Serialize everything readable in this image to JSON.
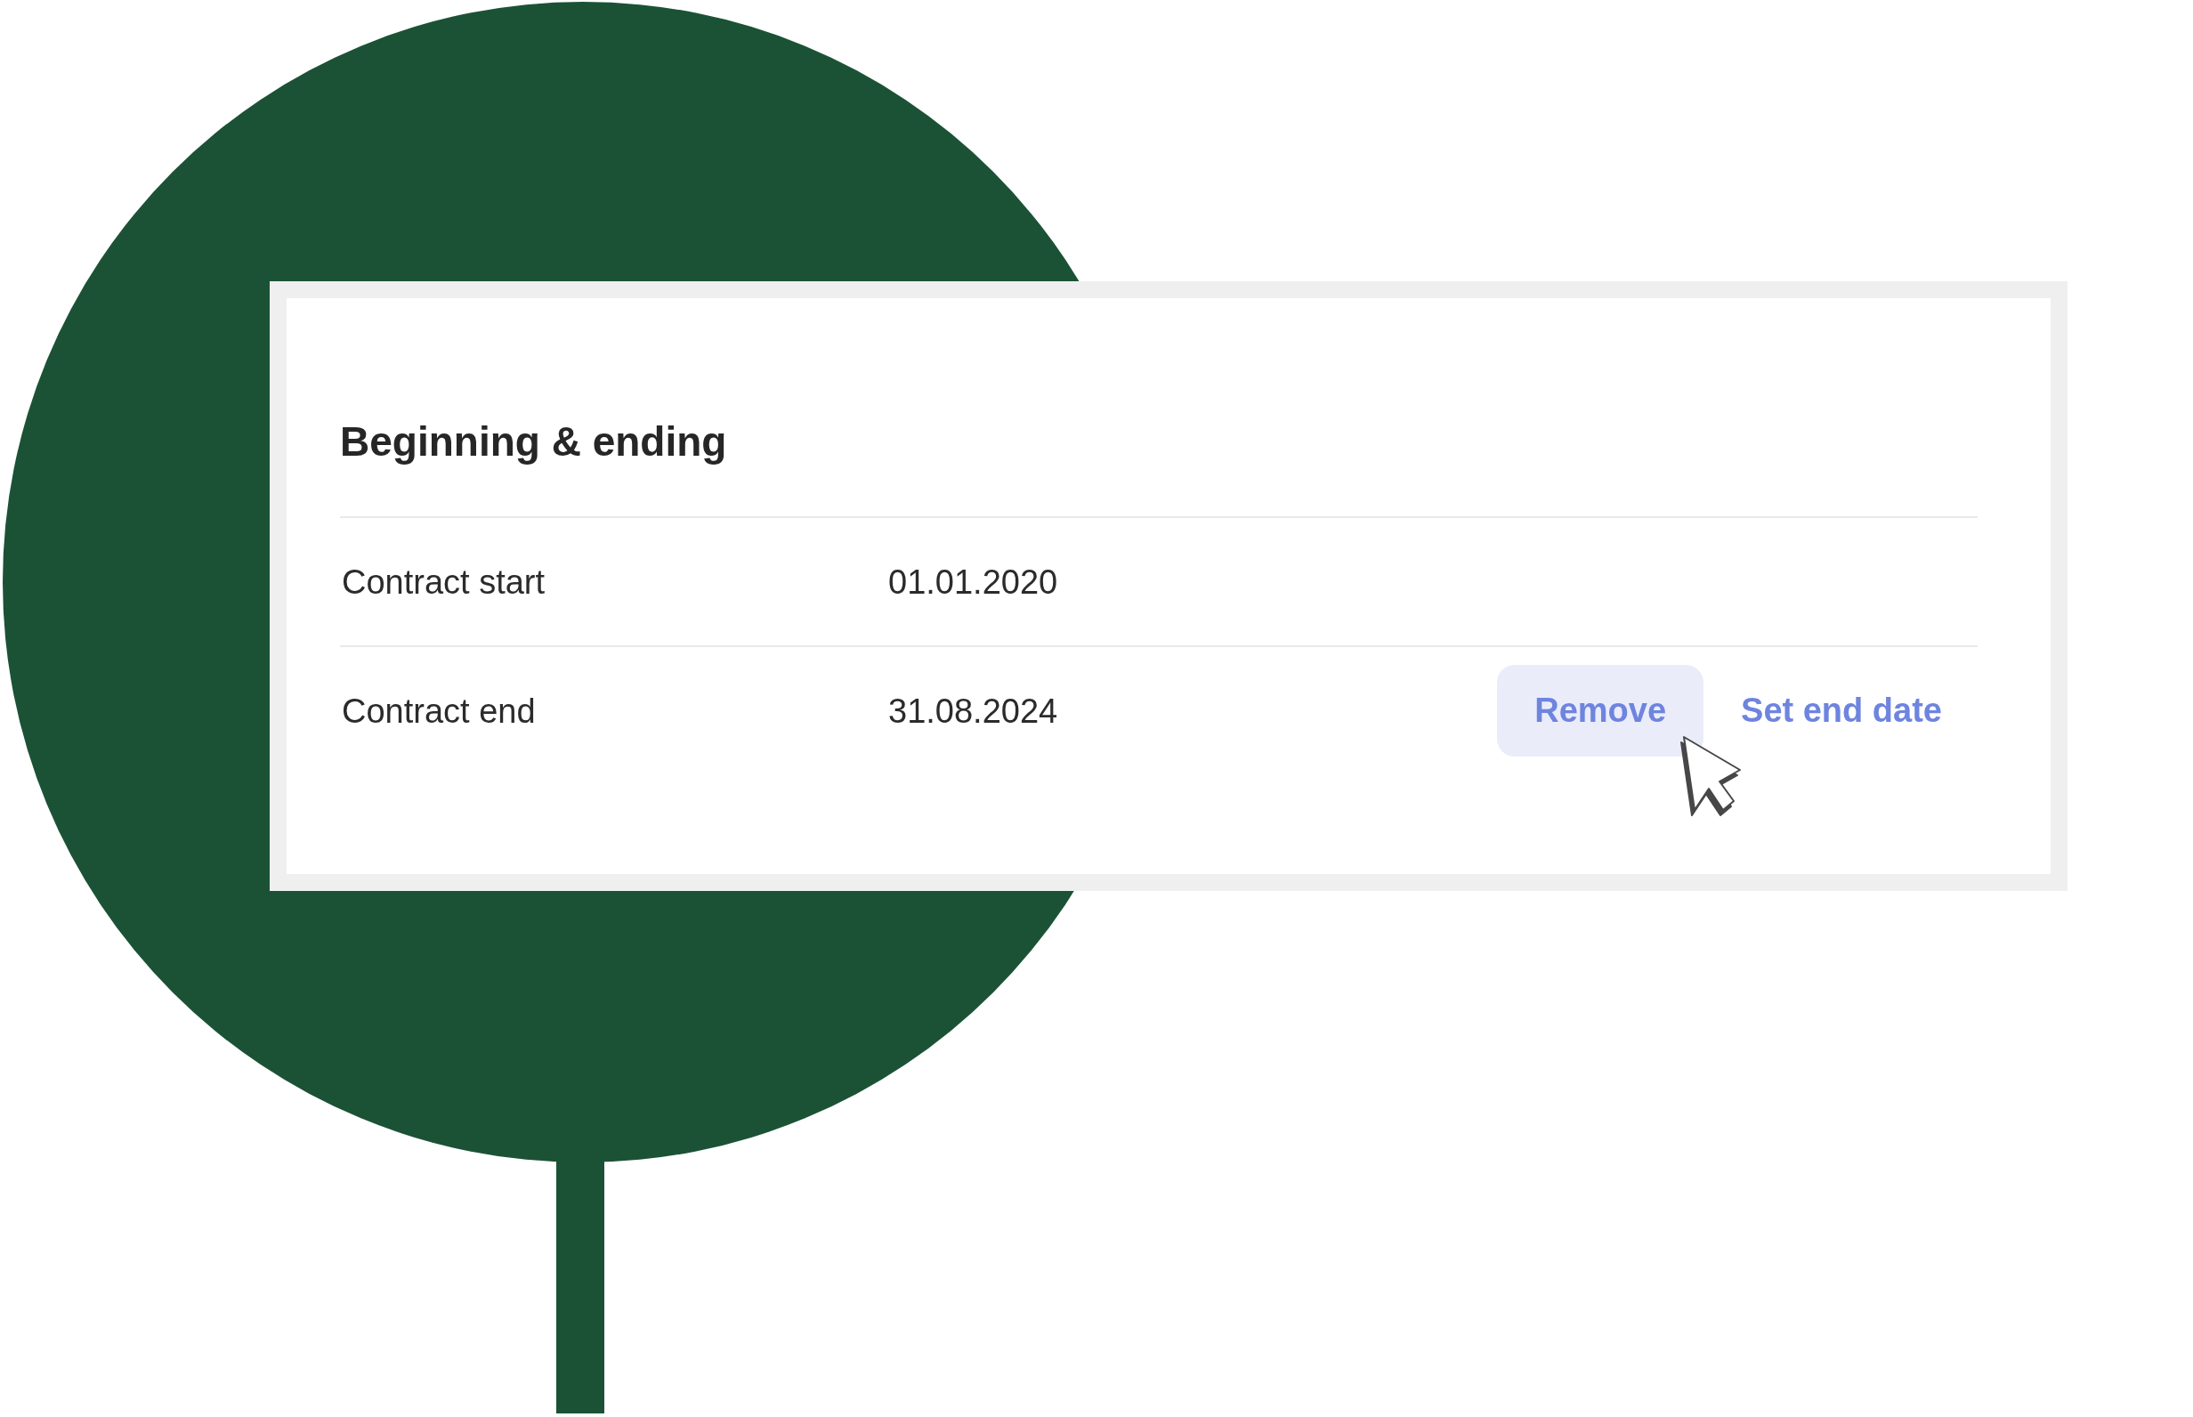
{
  "section": {
    "title": "Beginning & ending",
    "rows": [
      {
        "label": "Contract start",
        "value": "01.01.2020"
      },
      {
        "label": "Contract end",
        "value": "31.08.2024",
        "actions": [
          {
            "label": "Remove",
            "hovered": true
          },
          {
            "label": "Set end date",
            "hovered": false
          }
        ]
      }
    ]
  }
}
